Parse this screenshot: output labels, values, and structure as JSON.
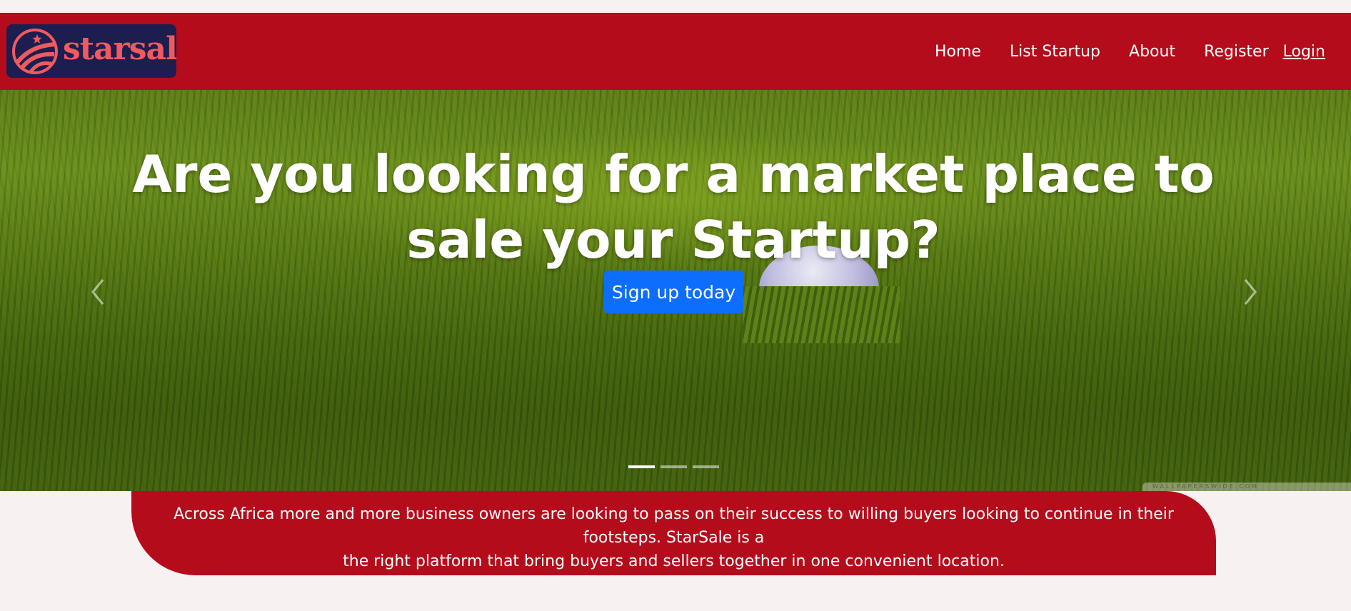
{
  "brand": {
    "name": "starsale",
    "colors": {
      "primary": "#b50c1c",
      "logo_background": "#1b1e4f",
      "logo_accent": "#f05a5e",
      "button": "#0d6efd",
      "page_background": "#f7f1f1"
    }
  },
  "nav": {
    "items": [
      {
        "label": "Home"
      },
      {
        "label": "List Startup"
      },
      {
        "label": "About"
      },
      {
        "label": "Register"
      },
      {
        "label": "Login"
      }
    ]
  },
  "hero": {
    "title_line1": "Are you looking for a market place to",
    "title_line2": "sale your Startup?",
    "cta_label": "Sign up today",
    "prev_icon": "chevron-left-icon",
    "next_icon": "chevron-right-icon",
    "slide_count": 3,
    "active_slide": 1,
    "watermark": "WALLPAPERSWIDE.COM"
  },
  "about": {
    "line1": "Across Africa more and more business owners are looking to pass on their success to willing buyers looking to continue in their footsteps. StarSale is a",
    "line2": "the right platform that bring buyers and sellers together in one convenient location."
  }
}
